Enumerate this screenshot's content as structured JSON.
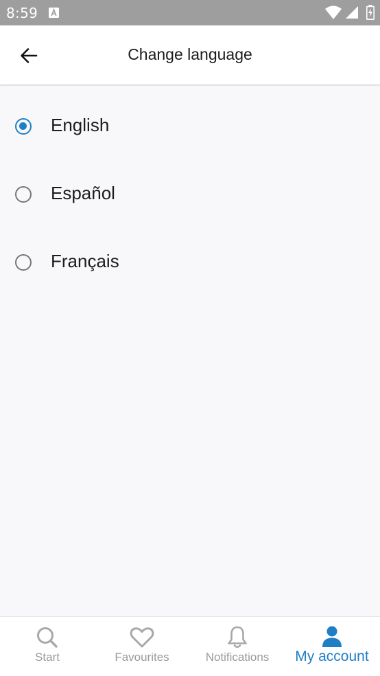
{
  "status_bar": {
    "time": "8:59",
    "notification_icon": "a-letter-icon",
    "icons": [
      "wifi-icon",
      "cell-signal-icon",
      "battery-icon"
    ]
  },
  "app_bar": {
    "back_icon": "arrow-left-icon",
    "title": "Change language"
  },
  "languages": [
    {
      "label": "English",
      "selected": true
    },
    {
      "label": "Español",
      "selected": false
    },
    {
      "label": "Français",
      "selected": false
    }
  ],
  "bottom_nav": {
    "items": [
      {
        "label": "Start",
        "icon": "search-icon",
        "active": false
      },
      {
        "label": "Favourites",
        "icon": "heart-icon",
        "active": false
      },
      {
        "label": "Notifications",
        "icon": "bell-icon",
        "active": false
      },
      {
        "label": "My account",
        "icon": "person-icon",
        "active": true
      }
    ]
  },
  "colors": {
    "accent": "#1e7fc6",
    "inactive": "#9a9a9a",
    "background": "#f8f8fa",
    "status_bar": "#9e9e9e"
  }
}
